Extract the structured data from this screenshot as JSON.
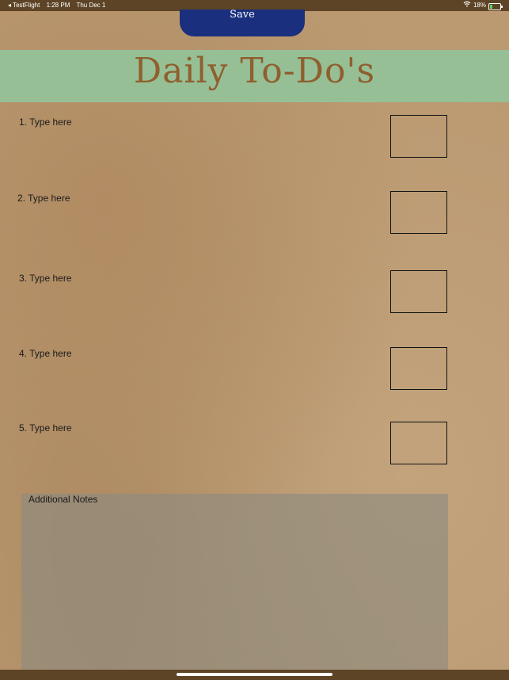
{
  "status_bar": {
    "back_app": "◂ TestFlight",
    "time": "1:28 PM",
    "date": "Thu Dec 1",
    "battery": "18%"
  },
  "toolbar": {
    "save_label": "Save"
  },
  "header": {
    "title": "Daily To-Do's"
  },
  "todos": [
    {
      "label": "1. Type here",
      "checked": false
    },
    {
      "label": "2. Type here",
      "checked": false
    },
    {
      "label": "3. Type here",
      "checked": false
    },
    {
      "label": "4. Type here",
      "checked": false
    },
    {
      "label": "5. Type here",
      "checked": false
    }
  ],
  "notes": {
    "label": "Additional Notes"
  },
  "colors": {
    "status_bar": "#5e4426",
    "save_button": "#1a2f7e",
    "title_band": "#97bf95",
    "title_text": "#8f5f2f",
    "notes_background": "#8c8a80"
  },
  "icons": [
    "wifi-icon",
    "battery-charging-icon"
  ]
}
